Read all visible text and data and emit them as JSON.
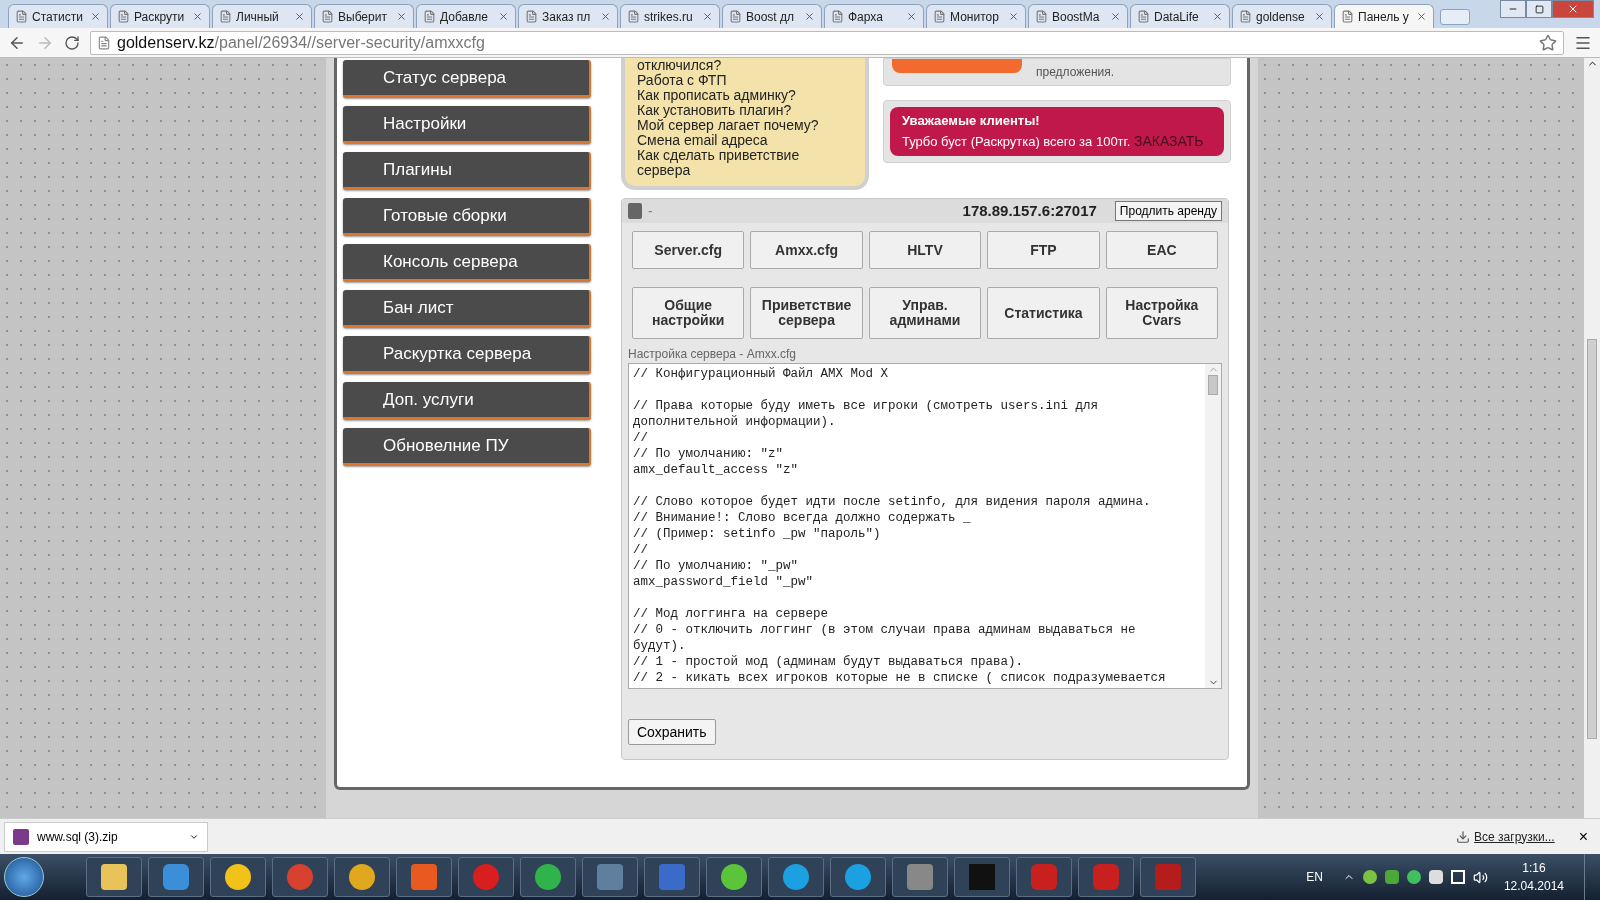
{
  "browser": {
    "tabs": [
      {
        "label": "Статисти",
        "selected": false
      },
      {
        "label": "Раскрути",
        "selected": false
      },
      {
        "label": "Личный",
        "selected": false
      },
      {
        "label": "Выберит",
        "selected": false
      },
      {
        "label": "Добавле",
        "selected": false
      },
      {
        "label": "Заказ пл",
        "selected": false
      },
      {
        "label": "strikes.ru",
        "selected": false
      },
      {
        "label": "Boost дл",
        "selected": false
      },
      {
        "label": "Фарха",
        "selected": false
      },
      {
        "label": "Монитор",
        "selected": false
      },
      {
        "label": "BoostMa",
        "selected": false
      },
      {
        "label": "DataLife",
        "selected": false
      },
      {
        "label": "goldense",
        "selected": false
      },
      {
        "label": "Панель у",
        "selected": true
      }
    ],
    "url": {
      "host": "goldenserv.kz",
      "path": "/panel/26934//server-security/amxxcfg"
    }
  },
  "sidebar": {
    "items": [
      "Статус сервера",
      "Настройки",
      "Плагины",
      "Готовые сборки",
      "Консоль сервера",
      "Бан лист",
      "Раскуртка сервера",
      "Доп. услуги",
      "Обновелние ПУ"
    ]
  },
  "faq": {
    "items": [
      "отключился?",
      "Работа с ФТП",
      "Как прописать админку?",
      "Как установить плагин?",
      "Мой сервер лагает почему?",
      "Смена email адреса",
      "Как сделать приветствие сервера"
    ]
  },
  "support_note": "предложения.",
  "promo": {
    "title": "Уважаемые клиенты!",
    "text": "Турбо буст (Раскрутка) всего за 100тг.",
    "link": "ЗАКАЗАТЬ"
  },
  "server": {
    "status": "-",
    "address": "178.89.157.6:27017",
    "renew_button": "Продлить аренду",
    "config_tabs": [
      "Server.cfg",
      "Amxx.cfg",
      "HLTV",
      "FTP",
      "EAC"
    ],
    "settings_tabs": [
      "Общие настройки",
      "Приветствие сервера",
      "Управ. админами",
      "Статистика",
      "Настройка Cvars"
    ],
    "editor": {
      "label": "Настройка сервера - Amxx.cfg",
      "blocks": [
        [
          "// Конфигурационный Файл AMX Mod X"
        ],
        [
          "// Права которые буду иметь все игроки (смотреть users.ini для дополнительной информации).",
          "//",
          "// По умолчанию: \"z\"",
          "amx_default_access \"z\""
        ],
        [
          "// Слово которое будет идти после setinfo, для видения пароля админа.",
          "// Внимание!: Слово всегда должно содержать _",
          "// (Пример: setinfo _pw \"пароль\")",
          "//",
          "// По умолчанию: \"_pw\"",
          "amx_password_field \"_pw\""
        ],
        [
          "// Мод логгинга на сервере",
          "// 0 - отключить логгинг (в этом случаи права админам выдаваться не будут).",
          "// 1 - простой мод (админам будут выдаваться права).",
          "// 2 - кикать всех игроков которые не в списке ( список подразумевается"
        ]
      ]
    },
    "save_button": "Сохранить"
  },
  "downloads": {
    "file": "www.sql (3).zip",
    "all_link": "Все загрузки...",
    "close": "×"
  },
  "taskbar": {
    "lang": "EN",
    "time": "1:16",
    "date": "12.04.2014"
  }
}
